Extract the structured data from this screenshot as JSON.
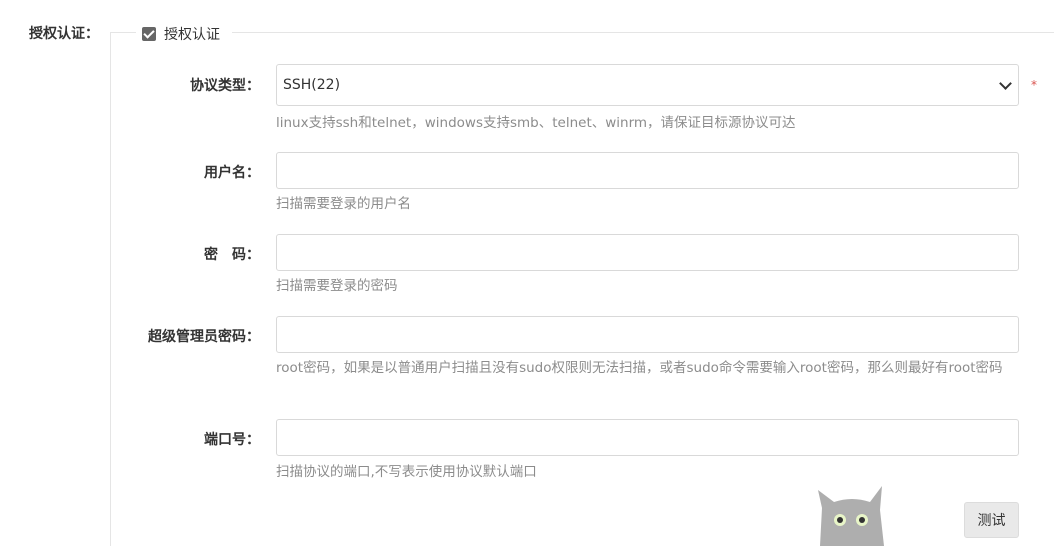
{
  "section": {
    "label": "授权认证："
  },
  "legend": {
    "checkbox_label": "授权认证",
    "checked": true
  },
  "form": {
    "protocol": {
      "label": "协议类型：",
      "value": "SSH(22)",
      "required_mark": "*",
      "help": "linux支持ssh和telnet，windows支持smb、telnet、winrm，请保证目标源协议可达"
    },
    "username": {
      "label": "用户名：",
      "value": "",
      "help": "扫描需要登录的用户名"
    },
    "password": {
      "label": "密　码：",
      "value": "",
      "help": "扫描需要登录的密码"
    },
    "super_password": {
      "label": "超级管理员密码：",
      "value": "",
      "help": "root密码，如果是以普通用户扫描且没有sudo权限则无法扫描，或者sudo命令需要输入root密码，那么则最好有root密码"
    },
    "port": {
      "label": "端口号：",
      "value": "",
      "help": "扫描协议的端口,不写表示使用协议默认端口"
    }
  },
  "actions": {
    "test_label": "测试"
  },
  "icons": {
    "checkbox": "checkbox-checked-icon",
    "dropdown": "chevron-down-icon",
    "mascot": "cat-mascot-icon"
  }
}
